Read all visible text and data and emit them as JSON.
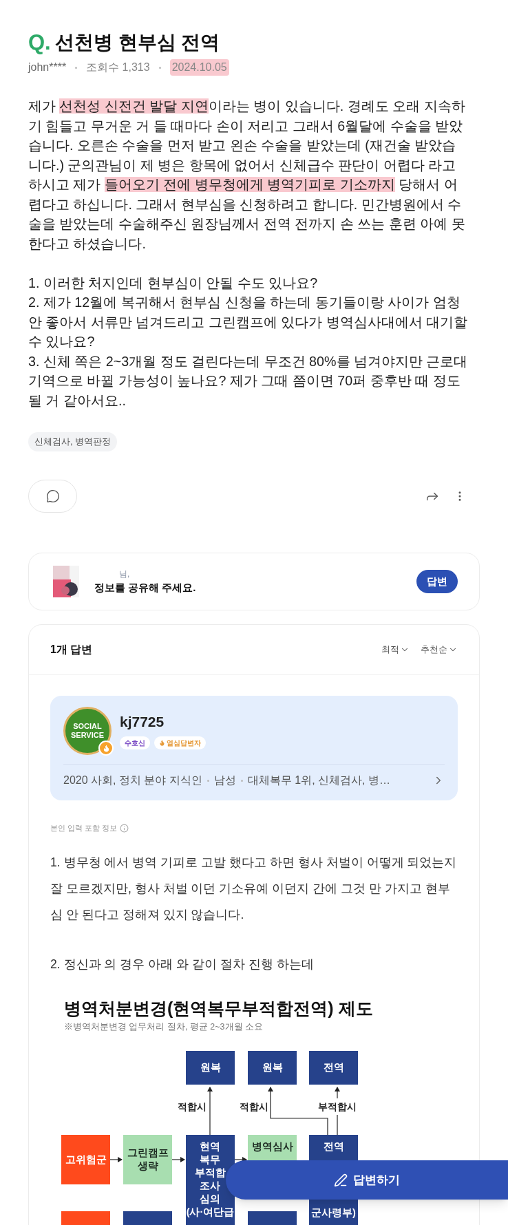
{
  "question": {
    "mark": "Q.",
    "title": "선천병 현부심 전역",
    "author": "john****",
    "views": "조회수 1,313",
    "date": {
      "text": "2024.10.05",
      "highlighted": true
    },
    "paragraphs": [
      [
        {
          "text": "제가 ",
          "highlighted": false
        },
        {
          "text": "선천성 신전건 발달 지연",
          "highlighted": true
        },
        {
          "text": "이라는 병이 있습니다. 경례도 오래 지속하기 힘들고 무거운 거 들 때마다 손이 저리고 그래서 6월달에 수술을 받았습니다. 오른손 수술을 먼저 받고 왼손 수술을 받았는데 (재건술 받았습니다.) 군의관님이 제 병은 항목에 없어서 신체급수 판단이 어렵다 라고 하시고 제가 ",
          "highlighted": false
        },
        {
          "text": "들어오기 전에 병무청에게 병역기피로 기소까지",
          "highlighted": true
        },
        {
          "text": " 당해서 어렵다고 하십니다. 그래서 현부심을 신청하려고 합니다. 민간병원에서 수술을 받았는데 수술해주신 원장님께서 전역 전까지 손 쓰는 훈련 아예 못한다고 하셨습니다.",
          "highlighted": false
        }
      ]
    ],
    "items": [
      "1. 이러한 처지인데 현부심이 안될 수도 있나요?",
      "2. 제가 12월에 복귀해서 현부심 신청을 하는데 동기들이랑 사이가 엄청 안 좋아서 서류만 넘겨드리고 그린캠프에 있다가 병역심사대에서 대기할 수 있나요?",
      "3. 신체 쪽은 2~3개월 정도 걸린다는데 무조건 80%를 넘겨야지만 근로대기역으로 바뀔 가능성이 높나요? 제가 그때 쯤이면 70퍼 중후반 때 정도 될 거 같아서요.."
    ],
    "tags": "신체검사, 병역판정"
  },
  "share_prompt": {
    "suffix": "님,",
    "message": "정보를 공유해 주세요.",
    "button": "답변"
  },
  "answers": {
    "count": "1개 답변",
    "sorts": [
      "최적",
      "추천순"
    ],
    "profile": {
      "badge_lines": [
        "SOCIAL",
        "SERVICE"
      ],
      "name": "kj7725",
      "chips": [
        {
          "label": "수호신",
          "kind": "grade"
        },
        {
          "label": "열심답변자",
          "kind": "hot"
        }
      ],
      "info": [
        "2020 사회, 정치 분야 지식인",
        "남성",
        "대체복무 1위, 신체검사, 병…"
      ]
    },
    "notice": "본인 입력 포함 정보",
    "paragraphs": [
      "1. 병무청 에서 병역 기피로 고발 했다고 하면 형사 처벌이 어떻게 되었는지 잘 모르겠지만, 형사 처벌 이던 기소유예 이던지 간에 그것 만 가지고 현부심 안 된다고 정해져 있지 않습니다.",
      "2. 정신과 의 경우 아래 와 같이 절차 진행 하는데"
    ],
    "diagram": {
      "title": "병역처분변경(현역복무부적합전역) 제도",
      "subtitle": "※병역처분변경 업무처리 절차, 평균 2~3개월 소요",
      "nodes": [
        {
          "kind": "navy",
          "lines": [
            "원복"
          ]
        },
        {
          "kind": "navy",
          "lines": [
            "원복"
          ]
        },
        {
          "kind": "navy",
          "lines": [
            "전역"
          ]
        },
        {
          "kind": "red",
          "lines": [
            "고위험군"
          ]
        },
        {
          "kind": "green",
          "lines": [
            "그린캠프",
            "생략"
          ]
        },
        {
          "kind": "navy",
          "lines": [
            "현역",
            "복무",
            "부적합",
            "조사",
            "심의",
            "(사·여단급"
          ]
        },
        {
          "kind": "green",
          "lines": [
            "병역심사"
          ]
        },
        {
          "kind": "navy",
          "lines": [
            "전역"
          ],
          "lower_lines": [
            "군사령부)"
          ]
        },
        {
          "kind": "red"
        },
        {
          "kind": "navy"
        },
        {
          "kind": "navy"
        }
      ],
      "labels": [
        "적합시",
        "적합시",
        "부적합시"
      ]
    }
  },
  "floating_button": "답변하기"
}
